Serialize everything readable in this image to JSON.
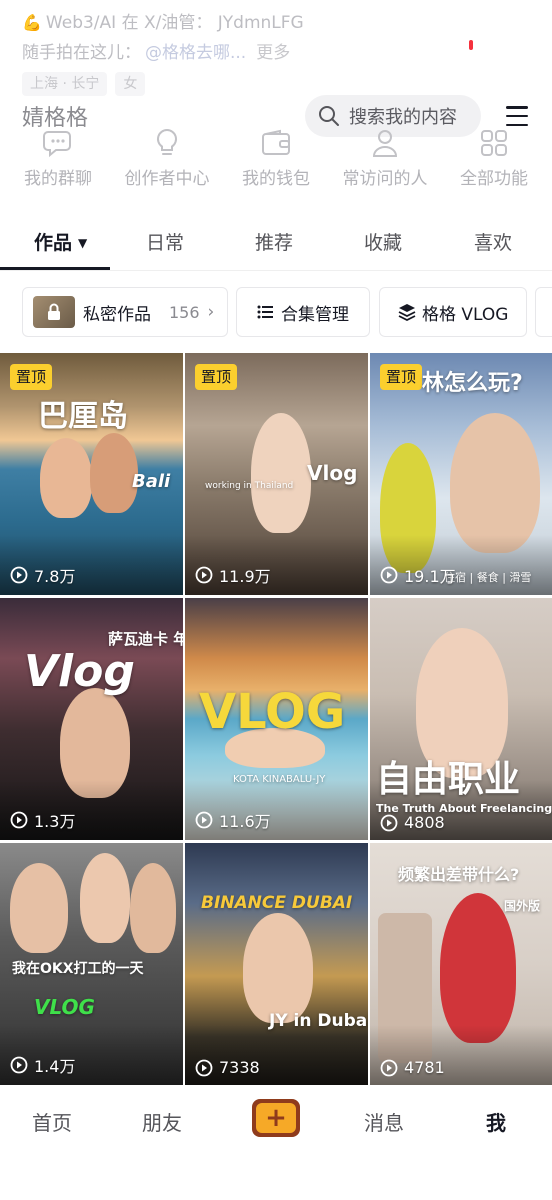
{
  "bio": {
    "line1": "Web3/AI 在 X/油管： JYdmnLFG",
    "line2_prefix": "随手拍在这儿：",
    "line2_mention": "@格格去哪...",
    "line2_more": "更多",
    "tags": [
      "上海 · 长宁",
      "女"
    ]
  },
  "header": {
    "nickname": "婧格格",
    "search_placeholder": "搜索我的内容",
    "menu_icon": "hamburger-icon"
  },
  "tools": [
    {
      "label": "我的群聊",
      "icon": "group-chat-icon"
    },
    {
      "label": "创作者中心",
      "icon": "lightbulb-icon"
    },
    {
      "label": "我的钱包",
      "icon": "wallet-icon"
    },
    {
      "label": "常访问的人",
      "icon": "person-icon"
    },
    {
      "label": "全部功能",
      "icon": "grid-icon"
    }
  ],
  "tabs": [
    {
      "label": "作品",
      "active": true
    },
    {
      "label": "日常"
    },
    {
      "label": "推荐"
    },
    {
      "label": "收藏"
    },
    {
      "label": "喜欢"
    }
  ],
  "chips": {
    "private": {
      "label": "私密作品",
      "count": "156",
      "arrow": "›"
    },
    "collection": {
      "label": "合集管理"
    },
    "vlog": {
      "label": "格格 VLOG"
    }
  },
  "pinned_label": "置顶",
  "videos": [
    {
      "title": "巴厘岛",
      "sub": "Bali",
      "views": "7.8万",
      "pinned": true
    },
    {
      "title": "Vlog",
      "sub": "working in Thailand",
      "views": "11.9万",
      "pinned": true
    },
    {
      "title": "林怎么玩?",
      "sub": "住宿 | 餐食 | 滑雪",
      "views": "19.1万",
      "pinned": true
    },
    {
      "title": "Vlog",
      "sub": "萨瓦迪卡 年夜饭",
      "views": "1.3万",
      "pinned": false
    },
    {
      "title": "VLOG",
      "sub": "KOTA KINABALU-JY",
      "views": "11.6万",
      "pinned": false
    },
    {
      "title": "自由职业",
      "sub": "The Truth About Freelancing",
      "views": "4808",
      "pinned": false
    },
    {
      "title": "我在OKX打工的一天",
      "sub": "VLOG",
      "views": "1.4万",
      "pinned": false
    },
    {
      "title": "JY in Dubai",
      "sub": "BINANCE DUBAI",
      "views": "7338",
      "pinned": false
    },
    {
      "title": "频繁出差带什么?",
      "sub": "国外版",
      "views": "4781",
      "pinned": false
    }
  ],
  "bottom_nav": [
    {
      "label": "首页"
    },
    {
      "label": "朋友"
    },
    {
      "label": "+"
    },
    {
      "label": "消息"
    },
    {
      "label": "我",
      "active": true
    }
  ],
  "colors": {
    "pin": "#fbcf2e",
    "plus_outer": "#8f3b1c",
    "plus_inner": "#f6a927",
    "accent_red": "#f5313d"
  }
}
